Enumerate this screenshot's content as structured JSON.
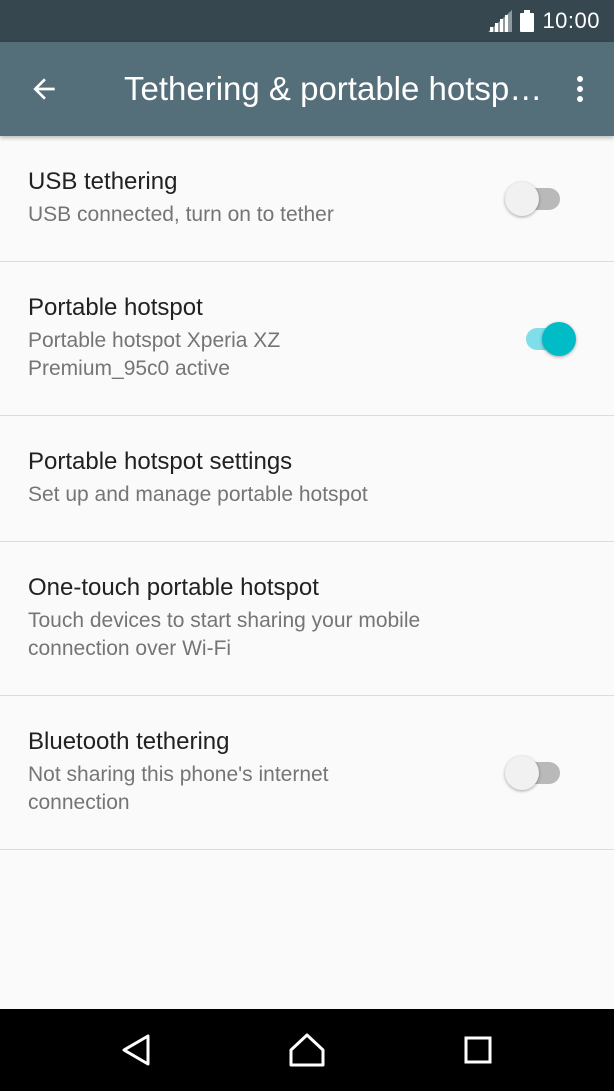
{
  "status_bar": {
    "time": "10:00",
    "icons": [
      "signal-icon",
      "battery-icon"
    ]
  },
  "app_bar": {
    "title": "Tethering & portable hotspots",
    "back_icon": "arrow-back-icon",
    "menu_icon": "more-vert-icon"
  },
  "settings": [
    {
      "title": "USB tethering",
      "subtitle": "USB connected, turn on to tether",
      "toggle": "off"
    },
    {
      "title": "Portable hotspot",
      "subtitle": "Portable hotspot Xperia XZ Premium_95c0 active",
      "toggle": "on"
    },
    {
      "title": "Portable hotspot settings",
      "subtitle": "Set up and manage portable hotspot"
    },
    {
      "title": "One-touch portable hotspot",
      "subtitle": "Touch devices to start sharing your mobile connection over Wi-Fi"
    },
    {
      "title": "Bluetooth tethering",
      "subtitle": "Not sharing this phone's internet connection",
      "toggle": "off"
    }
  ],
  "nav_bar": {
    "icons": [
      "back-triangle-icon",
      "home-icon",
      "recents-icon"
    ]
  },
  "colors": {
    "status_bar": "#36474f",
    "app_bar": "#546e7a",
    "accent": "#00bcc7",
    "background": "#fafafa"
  }
}
